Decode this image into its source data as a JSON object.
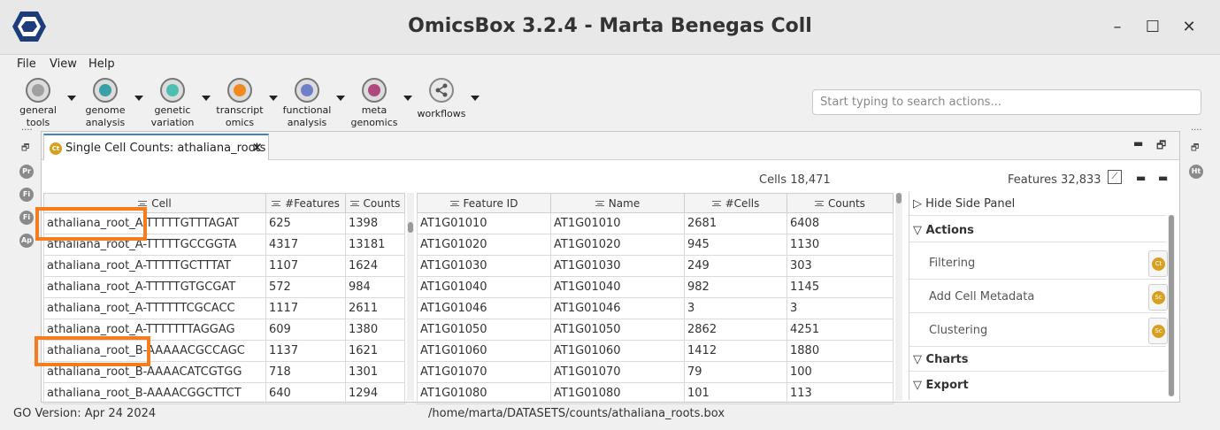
{
  "window": {
    "title": "OmicsBox 3.2.4 - Marta Benegas Coll"
  },
  "menu": [
    "File",
    "View",
    "Help"
  ],
  "toolbar": {
    "tools": [
      {
        "line1": "general",
        "line2": "tools",
        "color": "#a0a0a0"
      },
      {
        "line1": "genome",
        "line2": "analysis",
        "color": "#3aa0a8"
      },
      {
        "line1": "genetic",
        "line2": "variation",
        "color": "#4cc0b0"
      },
      {
        "line1": "transcript",
        "line2": "omics",
        "color": "#f08a20"
      },
      {
        "line1": "functional",
        "line2": "analysis",
        "color": "#7080c8"
      },
      {
        "line1": "meta",
        "line2": "genomics",
        "color": "#b04880"
      },
      {
        "line1": "workflows",
        "line2": "",
        "color": ""
      }
    ],
    "search_placeholder": "Start typing to search actions..."
  },
  "left_icons": [
    "Pr",
    "Fi",
    "Fi",
    "Ap"
  ],
  "right_icons": [
    "Ht"
  ],
  "tab": {
    "icon": "Ct",
    "label": "Single Cell Counts: athaliana_roots"
  },
  "cells_label": "Cells",
  "cells_value": "18,471",
  "features_label": "Features",
  "features_value": "32,833",
  "cells_table": {
    "headers": [
      "Cell",
      "#Features",
      "Counts"
    ],
    "rows": [
      [
        "athaliana_root_A-TTTTTGTTTAGAT",
        "625",
        "1398"
      ],
      [
        "athaliana_root_A-TTTTTGCCGGTA",
        "4317",
        "13181"
      ],
      [
        "athaliana_root_A-TTTTTGCTTTAT",
        "1107",
        "1624"
      ],
      [
        "athaliana_root_A-TTTTTGTGCGAT",
        "572",
        "984"
      ],
      [
        "athaliana_root_A-TTTTTTCGCACC",
        "1117",
        "2611"
      ],
      [
        "athaliana_root_A-TTTTTTTAGGAG",
        "609",
        "1380"
      ],
      [
        "athaliana_root_B-AAAAACGCCAGC",
        "1137",
        "1621"
      ],
      [
        "athaliana_root_B-AAAACATCGTGG",
        "718",
        "1301"
      ],
      [
        "athaliana_root_B-AAAACGGCTTCT",
        "640",
        "1294"
      ]
    ]
  },
  "features_table": {
    "headers": [
      "Feature ID",
      "Name",
      "#Cells",
      "Counts"
    ],
    "rows": [
      [
        "AT1G01010",
        "AT1G01010",
        "2681",
        "6408"
      ],
      [
        "AT1G01020",
        "AT1G01020",
        "945",
        "1130"
      ],
      [
        "AT1G01030",
        "AT1G01030",
        "249",
        "303"
      ],
      [
        "AT1G01040",
        "AT1G01040",
        "982",
        "1145"
      ],
      [
        "AT1G01046",
        "AT1G01046",
        "3",
        "3"
      ],
      [
        "AT1G01050",
        "AT1G01050",
        "2862",
        "4251"
      ],
      [
        "AT1G01060",
        "AT1G01060",
        "1412",
        "1880"
      ],
      [
        "AT1G01070",
        "AT1G01070",
        "79",
        "100"
      ],
      [
        "AT1G01080",
        "AT1G01080",
        "101",
        "113"
      ]
    ]
  },
  "side_panel": {
    "hide_label": "Hide Side Panel",
    "actions_label": "Actions",
    "actions": [
      {
        "label": "Filtering",
        "icon": "Ct"
      },
      {
        "label": "Add Cell Metadata",
        "icon": "Sc"
      },
      {
        "label": "Clustering",
        "icon": "Sc"
      }
    ],
    "charts_label": "Charts",
    "export_label": "Export"
  },
  "status": {
    "version": "GO Version: Apr 24 2024",
    "path": "/home/marta/DATASETS/counts/athaliana_roots.box"
  },
  "colors": {
    "highlight": "#f57c1f",
    "tab_accent": "#4a7fc0",
    "action_icon": "#d8a020"
  }
}
